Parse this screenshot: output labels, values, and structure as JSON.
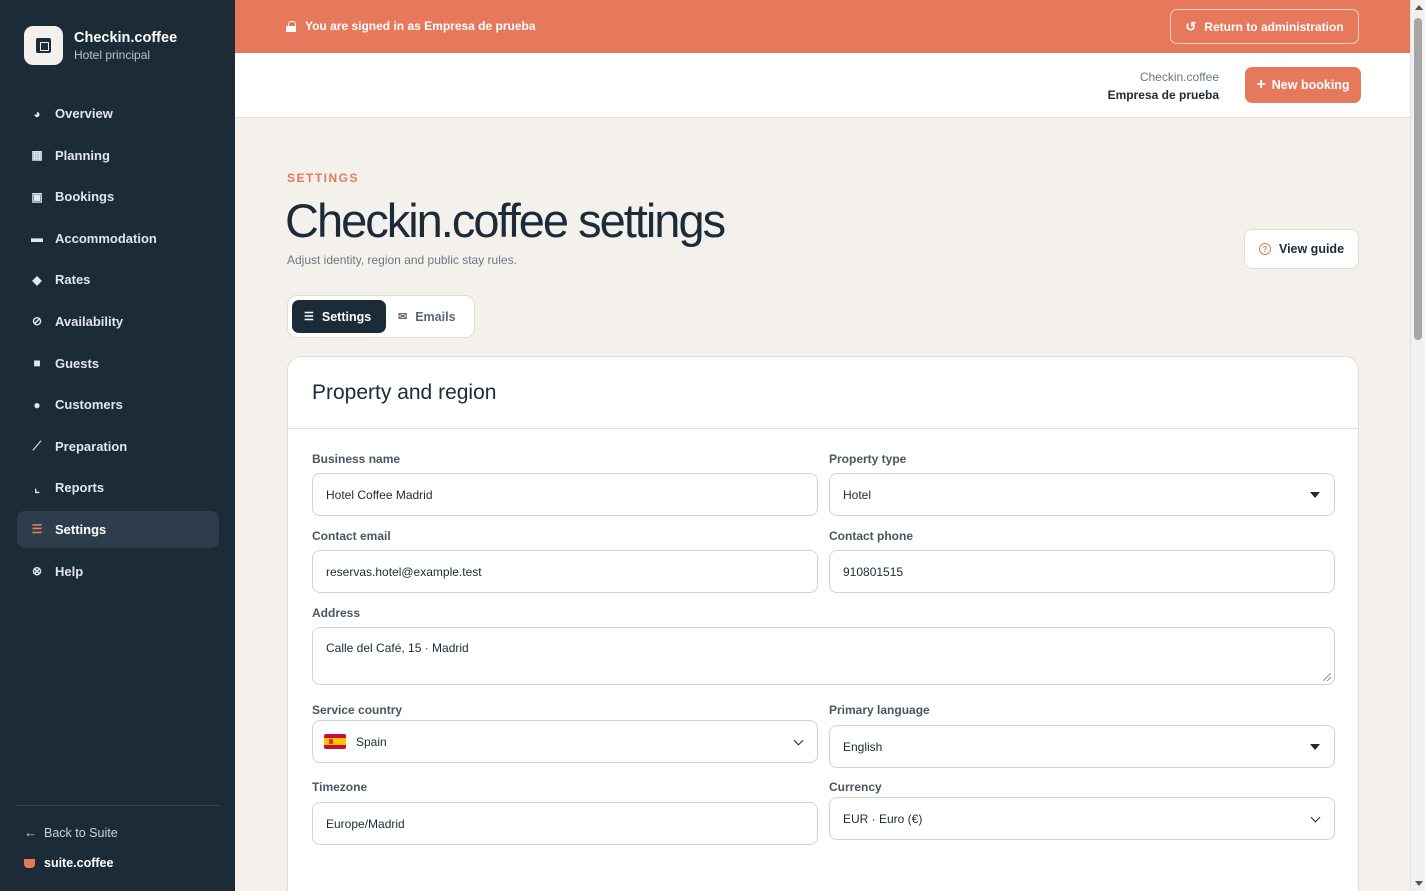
{
  "brand": {
    "title": "Checkin.coffee",
    "subtitle": "Hotel principal"
  },
  "sidebar": {
    "items": [
      {
        "label": "Overview",
        "icon": "pie-chart-icon"
      },
      {
        "label": "Planning",
        "icon": "calendar-icon"
      },
      {
        "label": "Bookings",
        "icon": "calendar-check-icon"
      },
      {
        "label": "Accommodation",
        "icon": "bed-icon"
      },
      {
        "label": "Rates",
        "icon": "tags-icon"
      },
      {
        "label": "Availability",
        "icon": "ban-icon"
      },
      {
        "label": "Guests",
        "icon": "suitcase-icon"
      },
      {
        "label": "Customers",
        "icon": "users-icon"
      },
      {
        "label": "Preparation",
        "icon": "broom-icon"
      },
      {
        "label": "Reports",
        "icon": "chart-line-icon"
      },
      {
        "label": "Settings",
        "icon": "sliders-icon",
        "active": true
      },
      {
        "label": "Help",
        "icon": "life-ring-icon"
      }
    ],
    "back_label": "Back to Suite",
    "suite_label": "suite.coffee"
  },
  "banner": {
    "message": "You are signed in as Empresa de prueba",
    "return_label": "Return to administration"
  },
  "topbar": {
    "brand": "Checkin.coffee",
    "company": "Empresa de prueba",
    "new_booking_label": "New booking"
  },
  "page": {
    "eyebrow": "SETTINGS",
    "title": "Checkin.coffee settings",
    "subtitle": "Adjust identity, region and public stay rules.",
    "view_guide_label": "View guide"
  },
  "tabs": [
    {
      "label": "Settings",
      "active": true
    },
    {
      "label": "Emails",
      "active": false
    }
  ],
  "card": {
    "title": "Property and region",
    "fields": {
      "business_name": {
        "label": "Business name",
        "value": "Hotel Coffee Madrid"
      },
      "property_type": {
        "label": "Property type",
        "value": "Hotel"
      },
      "contact_email": {
        "label": "Contact email",
        "value": "reservas.hotel@example.test"
      },
      "contact_phone": {
        "label": "Contact phone",
        "value": "910801515"
      },
      "address": {
        "label": "Address",
        "value": "Calle del Café, 15 · Madrid"
      },
      "service_country": {
        "label": "Service country",
        "value": "Spain"
      },
      "primary_language": {
        "label": "Primary language",
        "value": "English"
      },
      "timezone": {
        "label": "Timezone",
        "value": "Europe/Madrid"
      },
      "currency": {
        "label": "Currency",
        "value": "EUR · Euro (€)"
      }
    }
  },
  "colors": {
    "accent": "#e6795c",
    "sidebar_bg": "#1c2b38",
    "page_bg": "#f4f1ec"
  }
}
